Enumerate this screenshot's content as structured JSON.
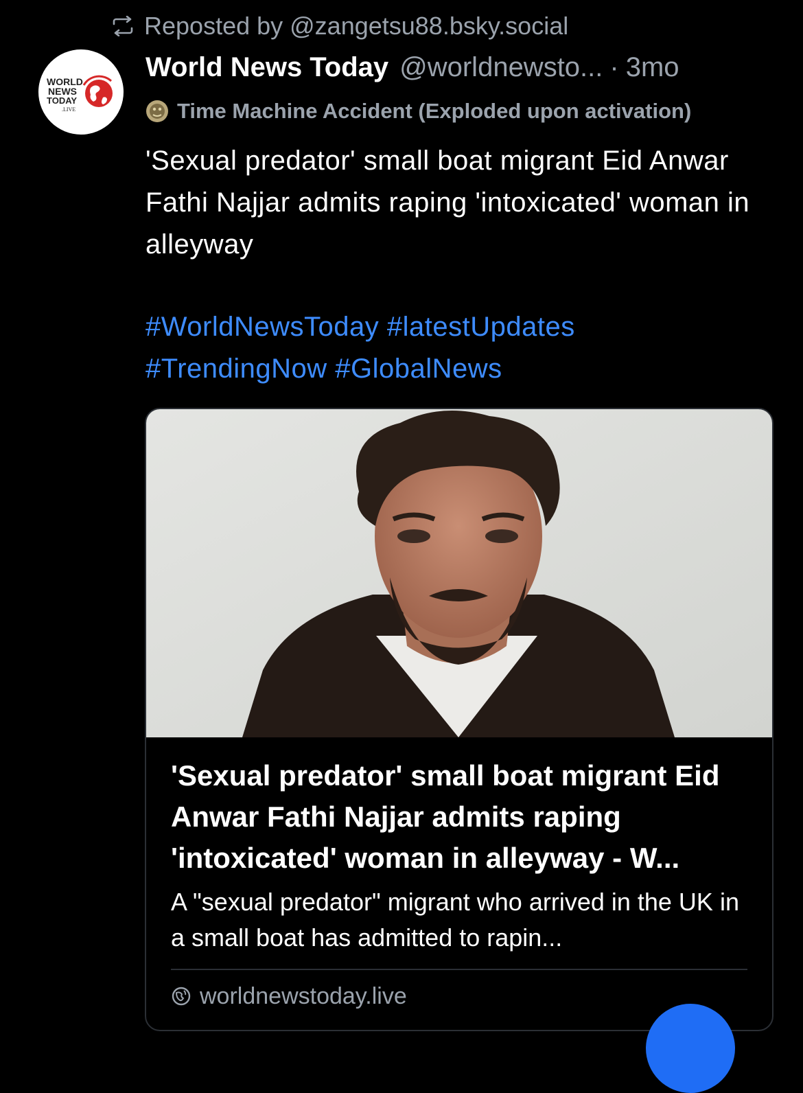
{
  "repost": {
    "icon": "repost-icon",
    "text": "Reposted by @zangetsu88.bsky.social"
  },
  "author": {
    "avatar_lines": [
      "WORLD",
      "NEWS",
      "TODAY",
      ".LIVE"
    ],
    "name": "World News Today",
    "handle": "@worldnewsto...",
    "separator": "·",
    "age": "3mo"
  },
  "label": {
    "icon": "label-badge-icon",
    "text": "Time Machine Accident (Exploded upon activation)"
  },
  "post": {
    "text": "'Sexual predator' small boat migrant Eid Anwar Fathi Najjar admits raping 'intoxicated' woman in alleyway",
    "hashtags": [
      "#WorldNewsToday",
      "#latestUpdates",
      "#TrendingNow",
      "#GlobalNews"
    ]
  },
  "link_card": {
    "image_alt": "mugshot-photo",
    "title": "'Sexual predator' small boat migrant Eid Anwar Fathi Najjar admits raping 'intoxicated' woman in alleyway - W...",
    "description": "A \"sexual predator\" migrant who arrived in the UK in a small boat has admitted to rapin...",
    "source_icon": "globe-icon",
    "source": "worldnewstoday.live"
  },
  "colors": {
    "background": "#000000",
    "muted_text": "#9ba3ad",
    "link": "#3e8cff",
    "fab": "#1f6df5",
    "brand_red": "#d62828"
  }
}
